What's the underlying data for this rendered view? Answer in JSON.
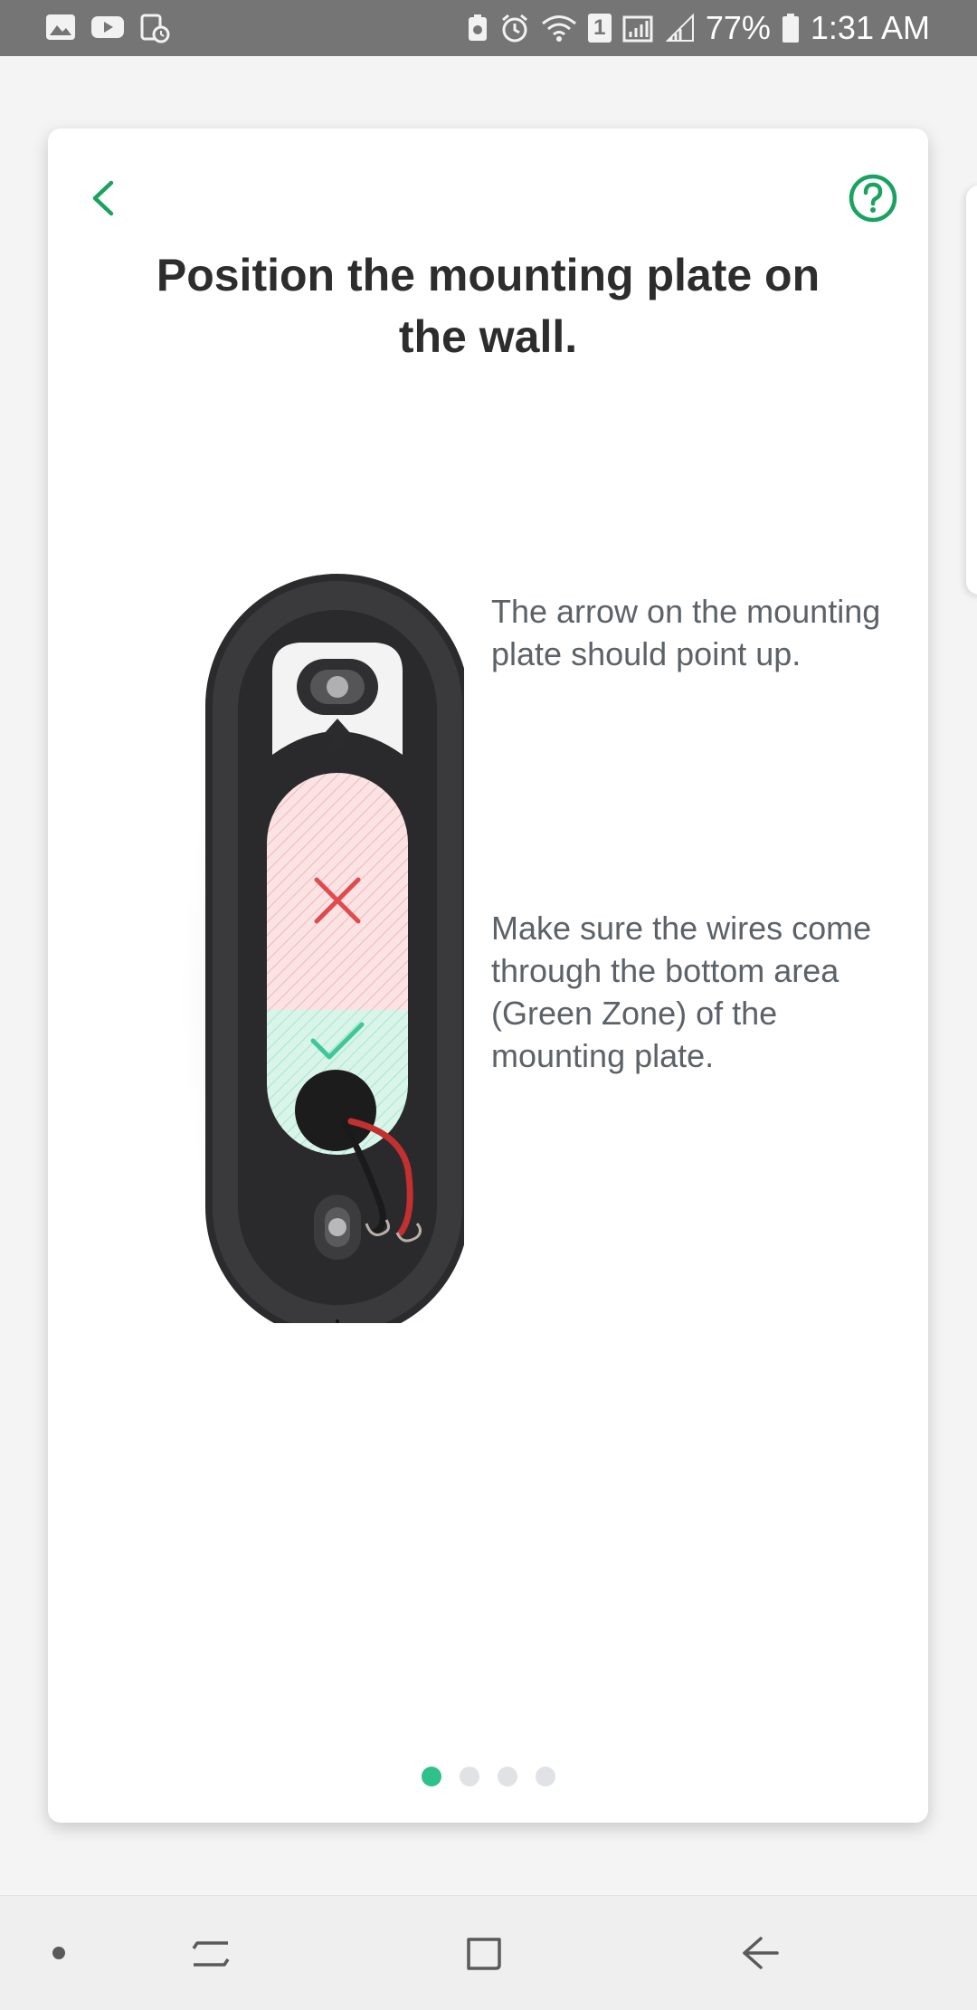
{
  "status_bar": {
    "battery": "77%",
    "time": "1:31 AM",
    "sim_slot": "1"
  },
  "screen": {
    "title": "Position the mounting plate on the wall.",
    "instructions": [
      "The arrow on the mounting plate should point up.",
      "Make sure the wires come through the bottom area (Green Zone) of the mounting plate."
    ],
    "illustration_icons": [
      "mounting-plate-illustration",
      "x-mark-icon",
      "check-mark-icon"
    ],
    "pagination": {
      "total": 4,
      "current": 1
    }
  },
  "colors": {
    "accent": "#1aa260",
    "page_dot_active": "#2fc18c",
    "title": "#2d2d2d",
    "body_text": "#5b6268",
    "red_zone": "#e24a4f",
    "green_zone": "#3ec79a"
  },
  "icons": {
    "back": "chevron-left-icon",
    "help": "question-circle-icon",
    "nav": [
      "dot-icon",
      "recent-apps-icon",
      "home-icon",
      "back-arrow-icon"
    ]
  }
}
